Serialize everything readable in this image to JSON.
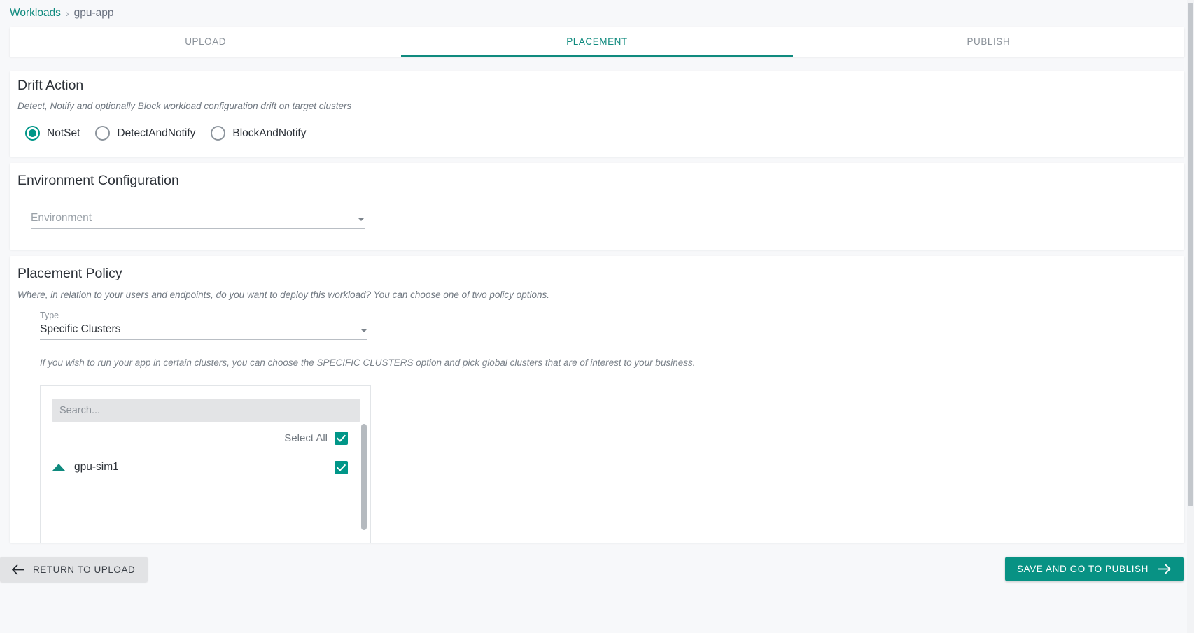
{
  "breadcrumb": {
    "root": "Workloads",
    "separator": "›",
    "current": "gpu-app"
  },
  "tabs": [
    {
      "label": "UPLOAD",
      "active": false
    },
    {
      "label": "PLACEMENT",
      "active": true
    },
    {
      "label": "PUBLISH",
      "active": false
    }
  ],
  "drift_action": {
    "title": "Drift Action",
    "description": "Detect, Notify and optionally Block workload configuration drift on target clusters",
    "options": [
      {
        "label": "NotSet",
        "selected": true
      },
      {
        "label": "DetectAndNotify",
        "selected": false
      },
      {
        "label": "BlockAndNotify",
        "selected": false
      }
    ]
  },
  "environment_configuration": {
    "title": "Environment Configuration",
    "select": {
      "placeholder": "Environment",
      "value": ""
    }
  },
  "placement_policy": {
    "title": "Placement Policy",
    "description": "Where, in relation to your users and endpoints, do you want to deploy this workload? You can choose one of two policy options.",
    "type_field": {
      "label": "Type",
      "value": "Specific Clusters"
    },
    "hint": "If you wish to run your app in certain clusters, you can choose the SPECIFIC CLUSTERS option and pick global clusters that are of interest to your business.",
    "cluster_picker": {
      "search_placeholder": "Search...",
      "search_value": "",
      "select_all_label": "Select All",
      "select_all_checked": true,
      "clusters": [
        {
          "name": "gpu-sim1",
          "checked": true,
          "expanded": true
        }
      ]
    }
  },
  "footer": {
    "back_label": "RETURN TO UPLOAD",
    "next_label": "SAVE AND GO TO PUBLISH"
  },
  "colors": {
    "accent": "#009688",
    "accent_dark": "#089284",
    "tab_active": "#0f8a7e",
    "page_bg": "#f7f8fa",
    "card_bg": "#ffffff",
    "text_primary": "#2c3138",
    "text_muted": "#6f7780"
  },
  "icons": {
    "back_arrow": "arrow-left",
    "forward_arrow": "arrow-right",
    "dropdown": "chevron-down",
    "expand": "triangle-up"
  }
}
